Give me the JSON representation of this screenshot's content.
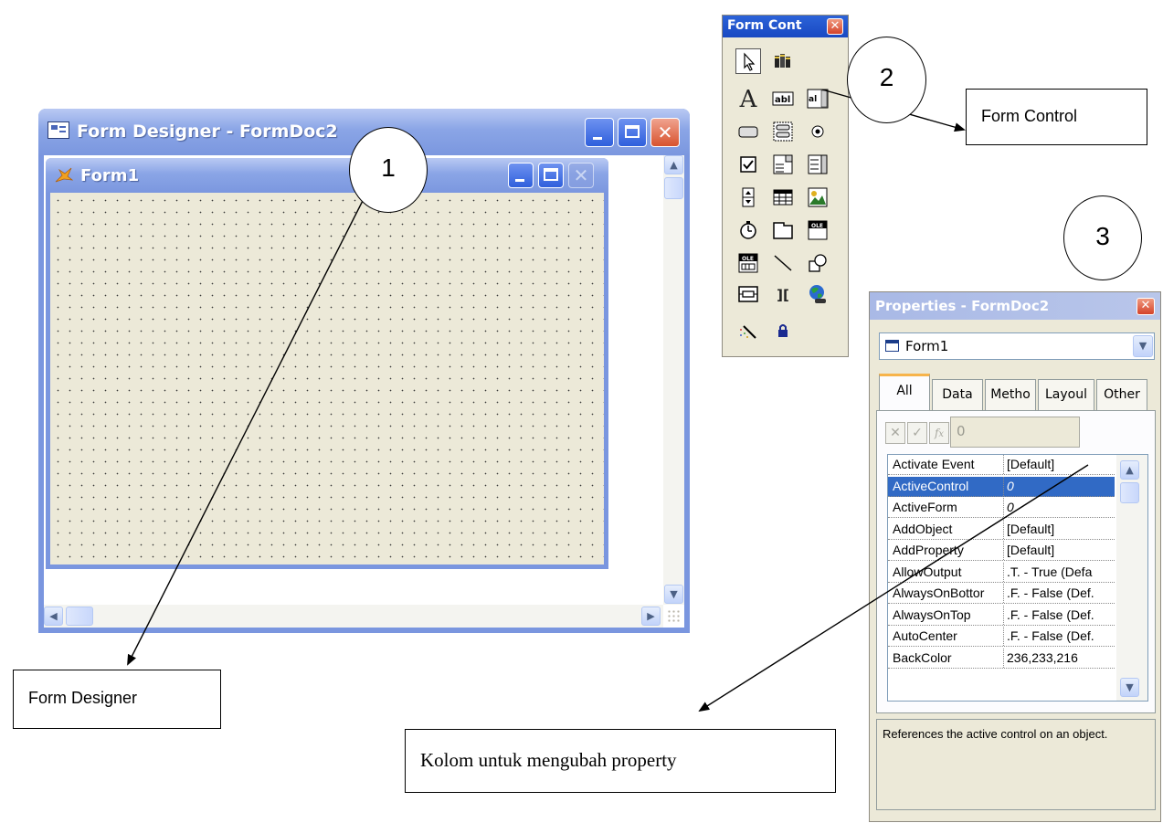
{
  "form_designer": {
    "title": "Form Designer - FormDoc2",
    "form1_title": "Form1"
  },
  "form_controls": {
    "title": "Form Cont",
    "tools": [
      "pointer",
      "view-classes",
      "label",
      "text-box",
      "edit-box",
      "command-button",
      "command-group",
      "option-group",
      "check-box",
      "combo-box",
      "list-box",
      "spinner",
      "grid",
      "image",
      "timer",
      "page-frame",
      "ole-container",
      "ole-bound",
      "line",
      "shape",
      "container",
      "separator",
      "hyperlink",
      "builder-lock",
      "button-lock"
    ]
  },
  "properties": {
    "title": "Properties - FormDoc2",
    "object": "Form1",
    "tabs": [
      "All",
      "Data",
      "Metho",
      "Layoul",
      "Other"
    ],
    "edit_value": "0",
    "rows": [
      {
        "name": "Activate Event",
        "value": "[Default]"
      },
      {
        "name": "ActiveControl",
        "value": "0"
      },
      {
        "name": "ActiveForm",
        "value": "0"
      },
      {
        "name": "AddObject",
        "value": "[Default]"
      },
      {
        "name": "AddProperty",
        "value": "[Default]"
      },
      {
        "name": "AllowOutput",
        "value": ".T. - True (Defa"
      },
      {
        "name": "AlwaysOnBottor",
        "value": ".F. - False (Def."
      },
      {
        "name": "AlwaysOnTop",
        "value": ".F. - False (Def."
      },
      {
        "name": "AutoCenter",
        "value": ".F. - False (Def."
      },
      {
        "name": "BackColor",
        "value": "236,233,216"
      }
    ],
    "description": "References the active control on an object."
  },
  "annotations": {
    "callout_1": "1",
    "callout_2": "2",
    "callout_3": "3",
    "label_form_designer": "Form Designer",
    "label_form_control": "Form Control",
    "label_property": "Kolom untuk mengubah property"
  }
}
